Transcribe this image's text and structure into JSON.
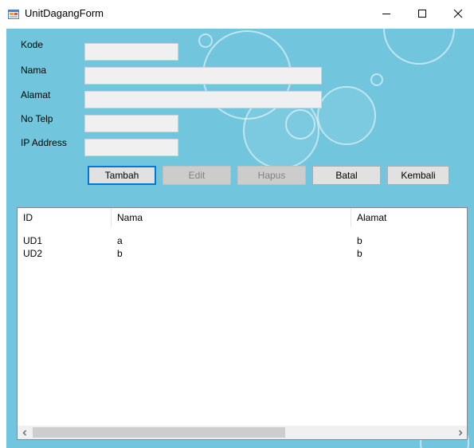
{
  "window": {
    "title": "UnitDagangForm"
  },
  "form": {
    "fields": [
      {
        "label": "Kode",
        "value": ""
      },
      {
        "label": "Nama",
        "value": ""
      },
      {
        "label": "Alamat",
        "value": ""
      },
      {
        "label": "No Telp",
        "value": ""
      },
      {
        "label": "IP Address",
        "value": ""
      }
    ],
    "buttons": {
      "tambah": "Tambah",
      "edit": "Edit",
      "hapus": "Hapus",
      "batal": "Batal",
      "kembali": "Kembali"
    }
  },
  "list": {
    "columns": [
      "ID",
      "Nama",
      "Alamat"
    ],
    "rows": [
      [
        "UD1",
        "a",
        "b"
      ],
      [
        "UD2",
        "b",
        "b"
      ]
    ]
  },
  "colors": {
    "form_background": "#71c6dd",
    "accent": "#0078d7"
  },
  "icons": {
    "app": "app-form-icon",
    "minimize": "minimize-icon",
    "maximize": "maximize-icon",
    "close": "close-icon",
    "scroll_left": "chevron-left-icon",
    "scroll_right": "chevron-right-icon"
  }
}
